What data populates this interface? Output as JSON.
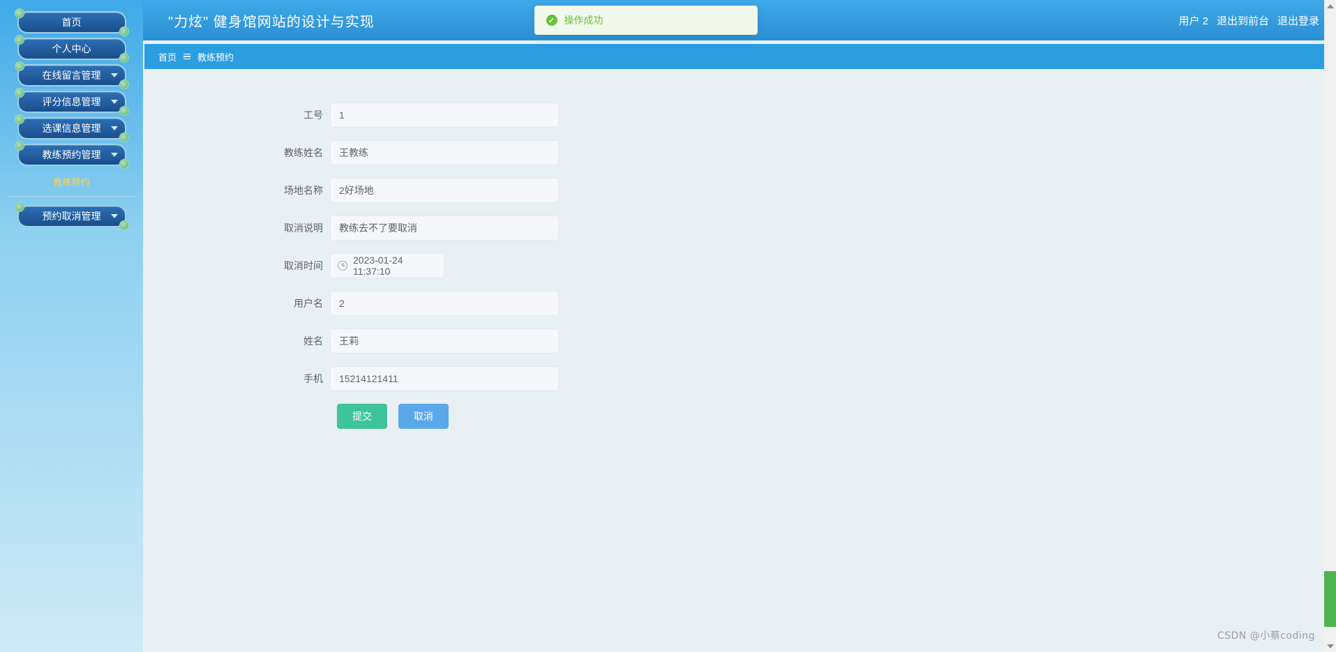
{
  "header": {
    "title": "\"力炫\" 健身馆网站的设计与实现",
    "user_label": "用户 2",
    "exit_front_label": "退出到前台",
    "logout_label": "退出登录"
  },
  "toast": {
    "message": "操作成功"
  },
  "breadcrumb": {
    "home": "首页",
    "current": "教练预约"
  },
  "sidebar": {
    "items": [
      {
        "label": "首页",
        "expandable": false
      },
      {
        "label": "个人中心",
        "expandable": false
      },
      {
        "label": "在线留言管理",
        "expandable": true
      },
      {
        "label": "评分信息管理",
        "expandable": true
      },
      {
        "label": "选课信息管理",
        "expandable": true
      },
      {
        "label": "教练预约管理",
        "expandable": true
      }
    ],
    "active_sub": "教练预约",
    "last_item": {
      "label": "预约取消管理",
      "expandable": true
    }
  },
  "form": {
    "fields": {
      "job_no": {
        "label": "工号",
        "value": "1"
      },
      "coach_name": {
        "label": "教练姓名",
        "value": "王教练"
      },
      "venue_name": {
        "label": "场地名称",
        "value": "2好场地"
      },
      "cancel_note": {
        "label": "取消说明",
        "value": "教练去不了要取消"
      },
      "cancel_time": {
        "label": "取消时间",
        "value": "2023-01-24 11:37:10"
      },
      "username": {
        "label": "用户名",
        "value": "2"
      },
      "real_name": {
        "label": "姓名",
        "value": "王莉"
      },
      "phone": {
        "label": "手机",
        "value": "15214121411"
      }
    },
    "submit_label": "提交",
    "cancel_label": "取消"
  },
  "watermark": "CSDN @小蔡coding"
}
